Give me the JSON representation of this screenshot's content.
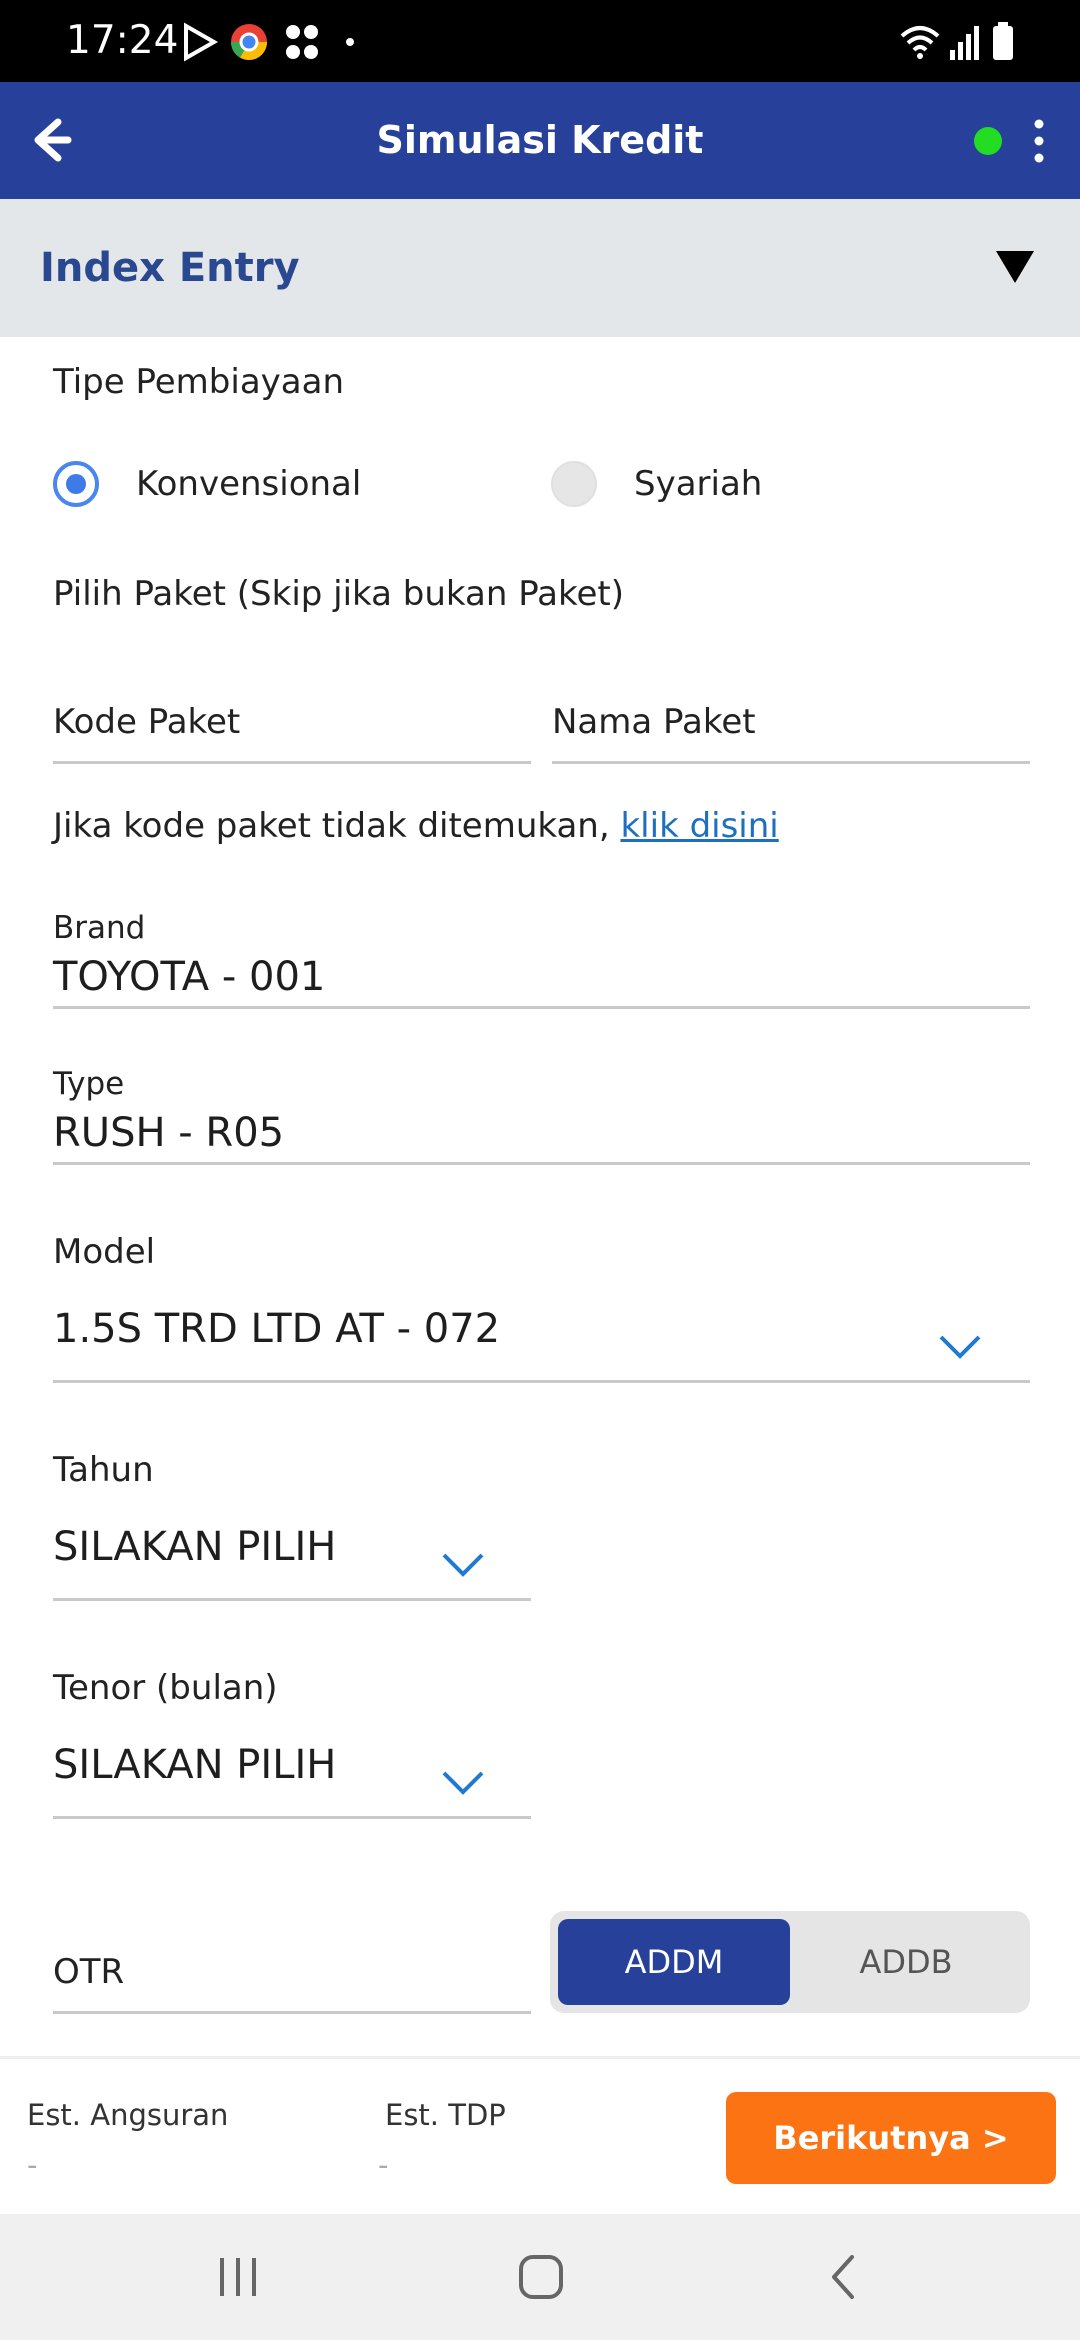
{
  "status_bar": {
    "time": "17:24",
    "icons": [
      "play-store-icon",
      "chrome-icon",
      "app-grid-icon",
      "dot-icon",
      "wifi-icon",
      "signal-icon",
      "battery-icon"
    ]
  },
  "app_bar": {
    "title": "Simulasi Kredit",
    "status_color": "#22dd22"
  },
  "section": {
    "title": "Index Entry"
  },
  "form": {
    "tipe_pembiayaan_label": "Tipe Pembiayaan",
    "options": [
      {
        "label": "Konvensional",
        "selected": true
      },
      {
        "label": "Syariah",
        "selected": false
      }
    ],
    "pilih_paket_label": "Pilih Paket (Skip jika bukan Paket)",
    "kode_paket_placeholder": "Kode Paket",
    "nama_paket_placeholder": "Nama Paket",
    "not_found_text": "Jika kode paket tidak ditemukan,",
    "not_found_link": "klik disini",
    "brand_label": "Brand",
    "brand_value": "TOYOTA - 001",
    "type_label": "Type",
    "type_value": "RUSH - R05",
    "model_label": "Model",
    "model_value": "1.5S TRD LTD AT - 072",
    "tahun_label": "Tahun",
    "tahun_value": "SILAKAN PILIH",
    "tenor_label": "Tenor (bulan)",
    "tenor_value": "SILAKAN PILIH",
    "otr_placeholder": "OTR",
    "toggle": {
      "selected": "ADDM",
      "options": [
        "ADDM",
        "ADDB"
      ]
    }
  },
  "summary": {
    "angsuran_label": "Est. Angsuran",
    "angsuran_value": "-",
    "tdp_label": "Est. TDP",
    "tdp_value": "-",
    "next_label": "Berikutnya >"
  },
  "colors": {
    "primary": "#27419a",
    "accent": "#fb7312",
    "link": "#1f6fc0",
    "section_bg": "#e3e7ea"
  }
}
